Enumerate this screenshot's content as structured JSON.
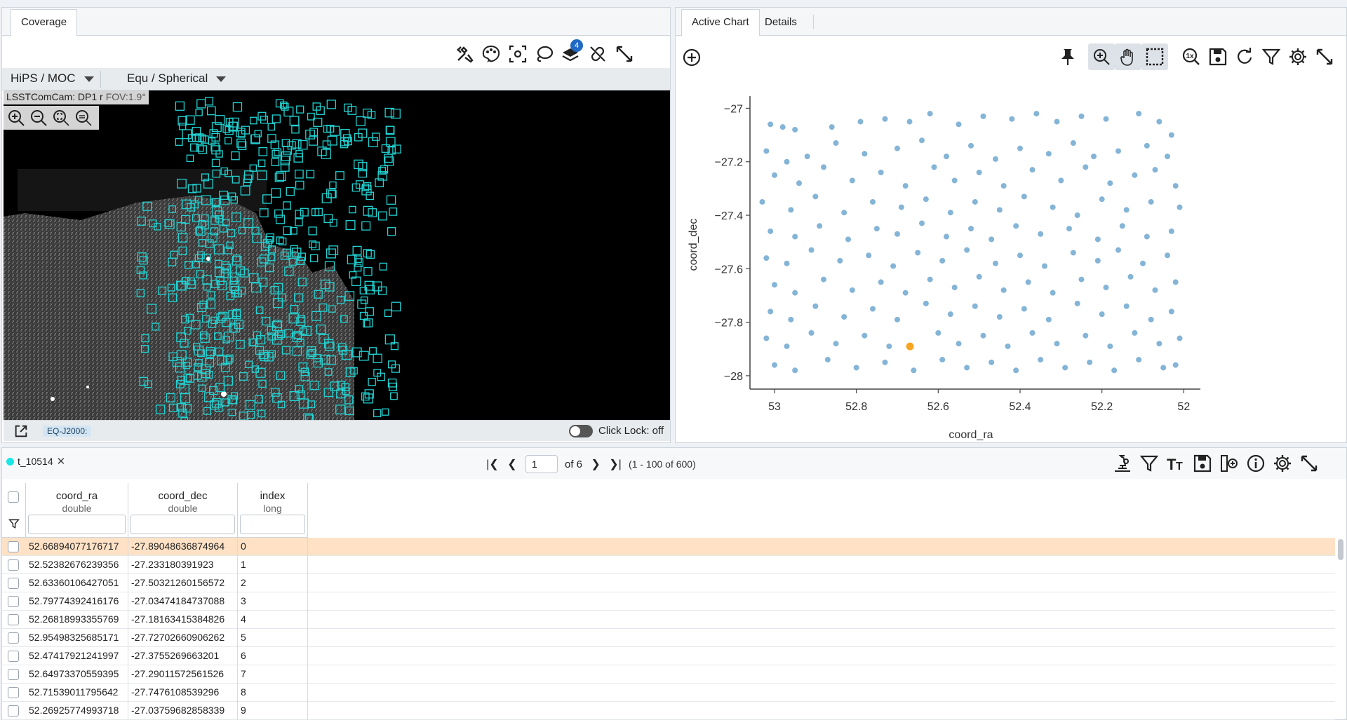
{
  "coverage": {
    "tab_label": "Coverage",
    "hips_label": "HiPS / MOC",
    "proj_label": "Equ / Spherical",
    "image_title": "LSSTComCam: DP1 r",
    "fov": "FOV:1.9°",
    "coord_sys": "EQ-J2000:",
    "click_lock": "Click Lock: off",
    "layer_badge": "4",
    "toolbar_icons": [
      "tools-icon",
      "palette-icon",
      "recenter-icon",
      "lasso-icon",
      "layers-icon",
      "unlink-icon",
      "expand-icon"
    ],
    "zoom_icons": [
      "zoom-in-icon",
      "zoom-out-icon",
      "zoom-fit-icon",
      "zoom-fill-icon"
    ]
  },
  "chart": {
    "tabs": [
      "Active Chart",
      "Details"
    ],
    "toolbar_icons": [
      "pin-icon",
      "zoom-mode-icon",
      "pan-icon",
      "select-icon",
      "reset-zoom-icon",
      "save-icon",
      "restore-icon",
      "filter-icon",
      "settings-icon",
      "expand-icon"
    ],
    "add_icon": "add-icon"
  },
  "chart_data": {
    "type": "scatter",
    "title": "",
    "xlabel": "coord_ra",
    "ylabel": "coord_dec",
    "xlim": [
      53.06,
      51.98
    ],
    "ylim": [
      -28.05,
      -26.97
    ],
    "x_reversed": true,
    "xticks": [
      "53",
      "52.8",
      "52.6",
      "52.4",
      "52.2",
      "52"
    ],
    "xtick_values": [
      53,
      52.8,
      52.6,
      52.4,
      52.2,
      52
    ],
    "yticks": [
      "−27",
      "−27.2",
      "−27.4",
      "−27.6",
      "−27.8",
      "−28"
    ],
    "ytick_values": [
      -27,
      -27.2,
      -27.4,
      -27.6,
      -27.8,
      -28
    ],
    "point_color": "#5b9bc8",
    "highlight_color": "#f5a623",
    "highlight_point": [
      52.66894077176717,
      -27.89048636874964
    ],
    "points": [
      [
        53.01,
        -27.06
      ],
      [
        52.98,
        -27.07
      ],
      [
        52.95,
        -27.08
      ],
      [
        52.86,
        -27.07
      ],
      [
        52.79,
        -27.05
      ],
      [
        52.73,
        -27.04
      ],
      [
        52.67,
        -27.05
      ],
      [
        52.62,
        -27.02
      ],
      [
        52.55,
        -27.06
      ],
      [
        52.49,
        -27.03
      ],
      [
        52.42,
        -27.04
      ],
      [
        52.36,
        -27.02
      ],
      [
        52.31,
        -27.05
      ],
      [
        52.25,
        -27.03
      ],
      [
        52.19,
        -27.04
      ],
      [
        52.11,
        -27.02
      ],
      [
        52.06,
        -27.05
      ],
      [
        52.03,
        -27.1
      ],
      [
        53.02,
        -27.16
      ],
      [
        52.97,
        -27.2
      ],
      [
        52.92,
        -27.18
      ],
      [
        52.85,
        -27.13
      ],
      [
        52.78,
        -27.17
      ],
      [
        52.7,
        -27.15
      ],
      [
        52.64,
        -27.12
      ],
      [
        52.58,
        -27.18
      ],
      [
        52.52,
        -27.14
      ],
      [
        52.46,
        -27.19
      ],
      [
        52.4,
        -27.15
      ],
      [
        52.33,
        -27.17
      ],
      [
        52.27,
        -27.13
      ],
      [
        52.22,
        -27.18
      ],
      [
        52.16,
        -27.16
      ],
      [
        52.09,
        -27.14
      ],
      [
        52.04,
        -27.18
      ],
      [
        53.0,
        -27.25
      ],
      [
        52.94,
        -27.28
      ],
      [
        52.88,
        -27.22
      ],
      [
        52.81,
        -27.27
      ],
      [
        52.74,
        -27.24
      ],
      [
        52.68,
        -27.29
      ],
      [
        52.61,
        -27.22
      ],
      [
        52.56,
        -27.27
      ],
      [
        52.5,
        -27.24
      ],
      [
        52.44,
        -27.29
      ],
      [
        52.37,
        -27.23
      ],
      [
        52.3,
        -27.27
      ],
      [
        52.24,
        -27.22
      ],
      [
        52.18,
        -27.28
      ],
      [
        52.12,
        -27.25
      ],
      [
        52.07,
        -27.23
      ],
      [
        52.02,
        -27.29
      ],
      [
        53.03,
        -27.35
      ],
      [
        52.96,
        -27.38
      ],
      [
        52.9,
        -27.33
      ],
      [
        52.83,
        -27.39
      ],
      [
        52.76,
        -27.35
      ],
      [
        52.69,
        -27.37
      ],
      [
        52.63,
        -27.34
      ],
      [
        52.57,
        -27.39
      ],
      [
        52.51,
        -27.35
      ],
      [
        52.45,
        -27.38
      ],
      [
        52.39,
        -27.33
      ],
      [
        52.32,
        -27.37
      ],
      [
        52.26,
        -27.4
      ],
      [
        52.2,
        -27.34
      ],
      [
        52.14,
        -27.38
      ],
      [
        52.08,
        -27.35
      ],
      [
        52.01,
        -27.37
      ],
      [
        53.01,
        -27.46
      ],
      [
        52.95,
        -27.48
      ],
      [
        52.89,
        -27.44
      ],
      [
        52.82,
        -27.49
      ],
      [
        52.75,
        -27.45
      ],
      [
        52.7,
        -27.47
      ],
      [
        52.64,
        -27.43
      ],
      [
        52.58,
        -27.48
      ],
      [
        52.52,
        -27.45
      ],
      [
        52.47,
        -27.49
      ],
      [
        52.41,
        -27.44
      ],
      [
        52.35,
        -27.47
      ],
      [
        52.28,
        -27.45
      ],
      [
        52.21,
        -27.49
      ],
      [
        52.15,
        -27.44
      ],
      [
        52.09,
        -27.48
      ],
      [
        52.03,
        -27.46
      ],
      [
        53.02,
        -27.56
      ],
      [
        52.97,
        -27.58
      ],
      [
        52.91,
        -27.53
      ],
      [
        52.84,
        -27.57
      ],
      [
        52.77,
        -27.55
      ],
      [
        52.71,
        -27.59
      ],
      [
        52.65,
        -27.54
      ],
      [
        52.59,
        -27.57
      ],
      [
        52.53,
        -27.53
      ],
      [
        52.46,
        -27.58
      ],
      [
        52.4,
        -27.55
      ],
      [
        52.34,
        -27.59
      ],
      [
        52.27,
        -27.54
      ],
      [
        52.21,
        -27.57
      ],
      [
        52.16,
        -27.53
      ],
      [
        52.1,
        -27.58
      ],
      [
        52.04,
        -27.55
      ],
      [
        53.0,
        -27.66
      ],
      [
        52.95,
        -27.69
      ],
      [
        52.88,
        -27.64
      ],
      [
        52.81,
        -27.68
      ],
      [
        52.74,
        -27.65
      ],
      [
        52.68,
        -27.69
      ],
      [
        52.62,
        -27.64
      ],
      [
        52.56,
        -27.67
      ],
      [
        52.5,
        -27.63
      ],
      [
        52.44,
        -27.68
      ],
      [
        52.38,
        -27.65
      ],
      [
        52.32,
        -27.69
      ],
      [
        52.25,
        -27.64
      ],
      [
        52.19,
        -27.67
      ],
      [
        52.13,
        -27.63
      ],
      [
        52.07,
        -27.68
      ],
      [
        52.02,
        -27.65
      ],
      [
        53.01,
        -27.76
      ],
      [
        52.96,
        -27.79
      ],
      [
        52.9,
        -27.74
      ],
      [
        52.83,
        -27.78
      ],
      [
        52.76,
        -27.75
      ],
      [
        52.7,
        -27.79
      ],
      [
        52.63,
        -27.73
      ],
      [
        52.57,
        -27.77
      ],
      [
        52.51,
        -27.74
      ],
      [
        52.45,
        -27.78
      ],
      [
        52.39,
        -27.75
      ],
      [
        52.33,
        -27.79
      ],
      [
        52.26,
        -27.73
      ],
      [
        52.2,
        -27.77
      ],
      [
        52.14,
        -27.74
      ],
      [
        52.08,
        -27.79
      ],
      [
        52.03,
        -27.76
      ],
      [
        53.02,
        -27.86
      ],
      [
        52.97,
        -27.89
      ],
      [
        52.91,
        -27.84
      ],
      [
        52.85,
        -27.88
      ],
      [
        52.78,
        -27.85
      ],
      [
        52.72,
        -27.89
      ],
      [
        52.6,
        -27.84
      ],
      [
        52.55,
        -27.88
      ],
      [
        52.49,
        -27.85
      ],
      [
        52.43,
        -27.89
      ],
      [
        52.37,
        -27.84
      ],
      [
        52.31,
        -27.88
      ],
      [
        52.24,
        -27.85
      ],
      [
        52.18,
        -27.89
      ],
      [
        52.12,
        -27.84
      ],
      [
        52.06,
        -27.88
      ],
      [
        52.01,
        -27.86
      ],
      [
        53.0,
        -27.96
      ],
      [
        52.95,
        -27.98
      ],
      [
        52.87,
        -27.94
      ],
      [
        52.8,
        -27.97
      ],
      [
        52.73,
        -27.95
      ],
      [
        52.66,
        -27.98
      ],
      [
        52.59,
        -27.94
      ],
      [
        52.53,
        -27.97
      ],
      [
        52.47,
        -27.95
      ],
      [
        52.41,
        -27.98
      ],
      [
        52.35,
        -27.94
      ],
      [
        52.29,
        -27.97
      ],
      [
        52.23,
        -27.95
      ],
      [
        52.17,
        -27.98
      ],
      [
        52.11,
        -27.94
      ],
      [
        52.05,
        -27.97
      ],
      [
        52.02,
        -27.96
      ]
    ]
  },
  "table": {
    "tab_label": "t_10514",
    "page_value": "1",
    "page_of": "of 6",
    "rows_info": "(1 - 100 of 600)",
    "columns": [
      {
        "name": "coord_ra",
        "type": "double"
      },
      {
        "name": "coord_dec",
        "type": "double"
      },
      {
        "name": "index",
        "type": "long"
      }
    ],
    "rows": [
      [
        "52.66894077176717",
        "-27.89048636874964",
        "0"
      ],
      [
        "52.52382676239356",
        "-27.233180391923",
        "1"
      ],
      [
        "52.63360106427051",
        "-27.50321260156572",
        "2"
      ],
      [
        "52.79774392416176",
        "-27.03474184737088",
        "3"
      ],
      [
        "52.26818993355769",
        "-27.18163415384826",
        "4"
      ],
      [
        "52.95498325685171",
        "-27.72702660906262",
        "5"
      ],
      [
        "52.47417921241997",
        "-27.3755269663201",
        "6"
      ],
      [
        "52.64973370559395",
        "-27.29011572561526",
        "7"
      ],
      [
        "52.71539011795642",
        "-27.7476108539296",
        "8"
      ],
      [
        "52.26925774993718",
        "-27.03759682858339",
        "9"
      ]
    ],
    "toolbar_icons": [
      "analyze-icon",
      "filter-icon",
      "text-view-icon",
      "save-icon",
      "add-column-icon",
      "info-icon",
      "settings-icon",
      "expand-icon"
    ]
  }
}
